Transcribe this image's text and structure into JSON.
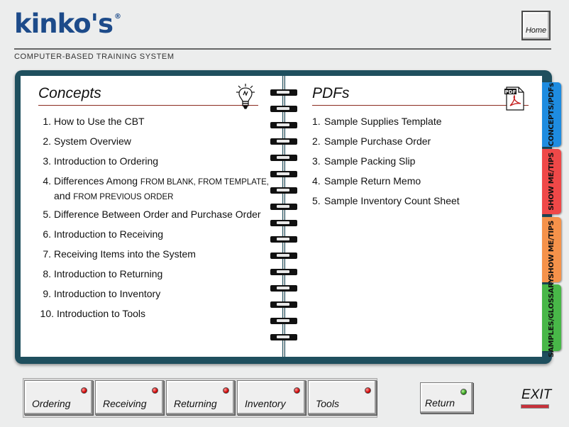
{
  "header": {
    "logo": "kinko's",
    "subtitle": "COMPUTER-BASED TRAINING SYSTEM",
    "home_label": "Home"
  },
  "concepts": {
    "title": "Concepts",
    "icon": "lightbulb-icon",
    "items": [
      {
        "num": "1.",
        "text": "How to Use the CBT"
      },
      {
        "num": "2.",
        "text": "System Overview"
      },
      {
        "num": "3.",
        "text": "Introduction to Ordering"
      },
      {
        "num": "4.",
        "text": "Differences Among ",
        "sc1": "FROM BLANK, FROM TEMPLATE,",
        "line2_pre": "and ",
        "sc2": "FROM PREVIOUS ORDER"
      },
      {
        "num": "5.",
        "text": "Difference Between Order and Purchase Order"
      },
      {
        "num": "6.",
        "text": "Introduction to Receiving"
      },
      {
        "num": "7.",
        "text": "Receiving Items into the System"
      },
      {
        "num": "8.",
        "text": "Introduction to Returning"
      },
      {
        "num": "9.",
        "text": "Introduction to Inventory"
      },
      {
        "num": "10.",
        "text": "Introduction to Tools"
      }
    ]
  },
  "pdfs": {
    "title": "PDFs",
    "icon": "pdf-file-icon",
    "icon_label": "PDF",
    "items": [
      {
        "num": "1.",
        "text": "Sample Supplies Template"
      },
      {
        "num": "2.",
        "text": "Sample Purchase Order"
      },
      {
        "num": "3.",
        "text": "Sample Packing Slip"
      },
      {
        "num": "4.",
        "text": "Sample Return Memo"
      },
      {
        "num": "5.",
        "text": "Sample Inventory Count Sheet"
      }
    ]
  },
  "tabs": [
    {
      "label": "CONCEPTS/PDFs",
      "color": "#1e8ce0"
    },
    {
      "label": "SHOW ME/TIPS",
      "color": "#ef4848"
    },
    {
      "label": "SHOW ME/TIPS",
      "color": "#f5924a"
    },
    {
      "label": "SAMPLES/GLOSSARY",
      "color": "#48b748"
    }
  ],
  "nav": {
    "buttons": [
      {
        "label": "Ordering",
        "led": "red"
      },
      {
        "label": "Receiving",
        "led": "red"
      },
      {
        "label": "Returning",
        "led": "red"
      },
      {
        "label": "Inventory",
        "led": "red"
      },
      {
        "label": "Tools",
        "led": "red"
      }
    ],
    "return_label": "Return",
    "return_led": "green",
    "exit_label": "EXIT"
  }
}
